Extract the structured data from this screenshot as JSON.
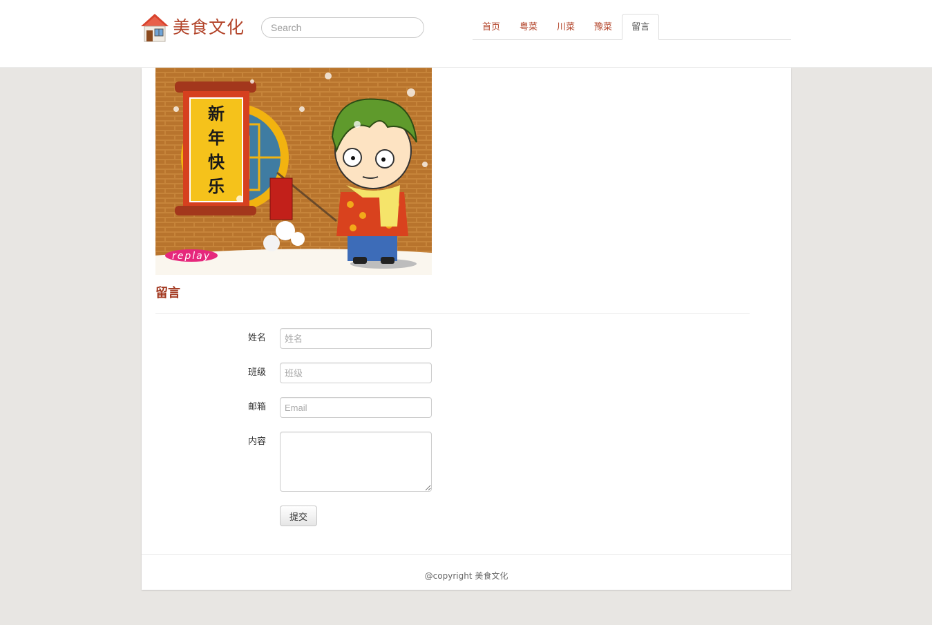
{
  "site": {
    "title": "美食文化"
  },
  "search": {
    "placeholder": "Search"
  },
  "nav": {
    "tabs": [
      {
        "label": "首页",
        "active": false
      },
      {
        "label": "粤菜",
        "active": false
      },
      {
        "label": "川菜",
        "active": false
      },
      {
        "label": "豫菜",
        "active": false
      },
      {
        "label": "留言",
        "active": true
      }
    ]
  },
  "banner": {
    "scroll_text": [
      "新",
      "年",
      "快",
      "乐"
    ],
    "replay_label": "replay"
  },
  "section": {
    "title": "留言"
  },
  "form": {
    "name_label": "姓名",
    "name_placeholder": "姓名",
    "class_label": "班级",
    "class_placeholder": "班级",
    "email_label": "邮箱",
    "email_placeholder": "Email",
    "content_label": "内容",
    "submit_label": "提交"
  },
  "footer": {
    "text": "@copyright 美食文化"
  },
  "colors": {
    "brand": "#b3452b",
    "title": "#a33a22",
    "background": "#e8e6e3"
  }
}
